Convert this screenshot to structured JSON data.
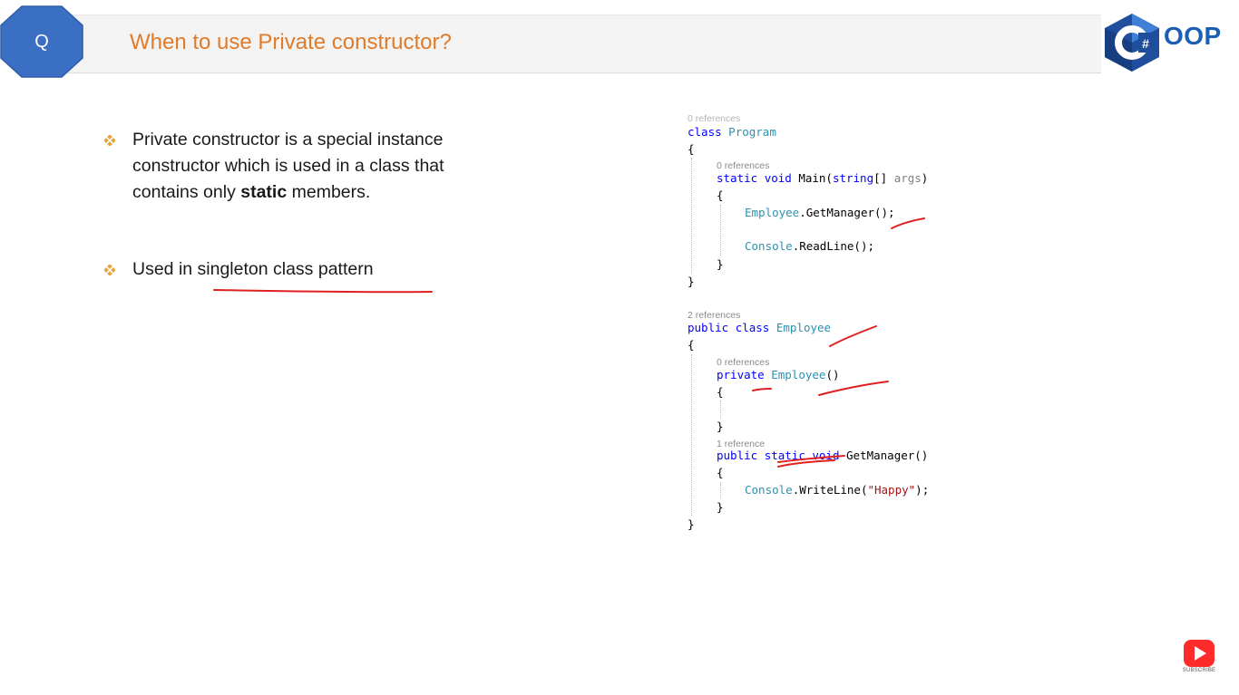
{
  "header": {
    "badge": "Q",
    "title": "When to use Private constructor?",
    "logo_text": "OOP",
    "logo_glyph": "#"
  },
  "bullets": [
    {
      "pre": "Private constructor is a special instance constructor which is used in a class that contains only ",
      "bold": "static",
      "post": " members."
    },
    {
      "pre": "Used in singleton class pattern",
      "bold": "",
      "post": ""
    }
  ],
  "code": {
    "refs_top": "0 references",
    "line_class_program": "class Program",
    "brace_open": "{",
    "brace_close": "}",
    "refs_main": "0 references",
    "line_main": "static void Main(string[] args)",
    "line_getmanager_call": "Employee.GetManager();",
    "line_readline": "Console.ReadLine();",
    "refs_employee": "2 references",
    "line_class_employee": "public class Employee",
    "refs_ctor": "0 references",
    "line_ctor": "private Employee()",
    "refs_method": "1 reference",
    "line_method": "public static void GetManager()",
    "line_writeline": "Console.WriteLine(\"Happy\");"
  },
  "colors": {
    "title": "#e07b2a",
    "badge": "#3a6fc4",
    "keyword": "#0000ff",
    "type": "#2b91af",
    "string": "#a31515",
    "ink": "#e02020",
    "bullet": "#e8a33a"
  },
  "subscribe": {
    "label": "SUBSCRIBE"
  }
}
